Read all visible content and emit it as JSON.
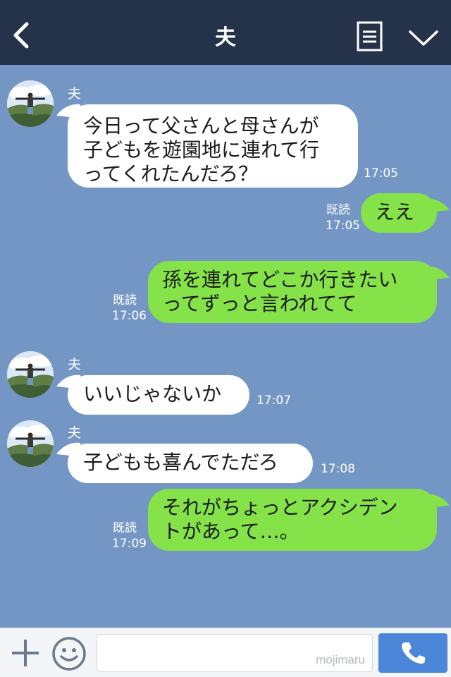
{
  "header": {
    "title": "夫",
    "icons": {
      "back": "chevron-left-icon",
      "menu": "document-list-icon",
      "collapse": "chevron-down-icon"
    }
  },
  "messages": [
    {
      "direction": "incoming",
      "sender": "夫",
      "lines": [
        "今日って父さんと母さんが",
        "子どもを遊園地に連れて行",
        "ってくれたんだろ？"
      ],
      "time": "17:05"
    },
    {
      "direction": "outgoing",
      "read": "既読",
      "lines": [
        "ええ"
      ],
      "time": "17:05"
    },
    {
      "direction": "outgoing",
      "read": "既読",
      "lines": [
        "孫を連れてどこか行きたい",
        "ってずっと言われてて"
      ],
      "time": "17:06"
    },
    {
      "direction": "incoming",
      "sender": "夫",
      "lines": [
        "いいじゃないか"
      ],
      "time": "17:07"
    },
    {
      "direction": "incoming",
      "sender": "夫",
      "lines": [
        "子どもも喜んでただろ"
      ],
      "time": "17:08"
    },
    {
      "direction": "outgoing",
      "read": "既読",
      "lines": [
        "それがちょっとアクシデン",
        "トがあって…。"
      ],
      "time": "17:09"
    }
  ],
  "input_bar": {
    "watermark": "mojimaru",
    "icons": {
      "add": "plus-icon",
      "emoji": "smiley-icon",
      "call": "phone-icon"
    }
  },
  "colors": {
    "header_bg": "#243349",
    "chat_bg": "#7396c4",
    "incoming_bubble": "#ffffff",
    "outgoing_bubble": "#85e249",
    "call_button": "#4c86d9"
  }
}
